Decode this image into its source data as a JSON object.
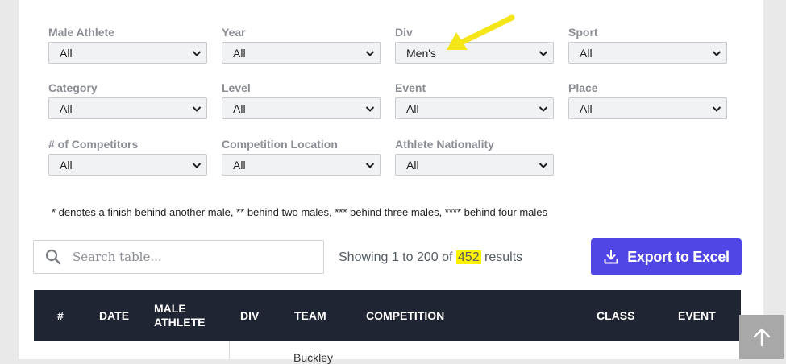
{
  "filters": [
    {
      "label": "Male Athlete",
      "value": "All"
    },
    {
      "label": "Year",
      "value": "All"
    },
    {
      "label": "Div",
      "value": "Men's"
    },
    {
      "label": "Sport",
      "value": "All"
    },
    {
      "label": "Category",
      "value": "All"
    },
    {
      "label": "Level",
      "value": "All"
    },
    {
      "label": "Event",
      "value": "All"
    },
    {
      "label": "Place",
      "value": "All"
    },
    {
      "label": "# of Competitors",
      "value": "All"
    },
    {
      "label": "Competition Location",
      "value": "All"
    },
    {
      "label": "Athlete Nationality",
      "value": "All"
    }
  ],
  "note": "* denotes a finish behind another male, ** behind two males, *** behind three males, **** behind four males",
  "search": {
    "placeholder": "Search table..."
  },
  "results": {
    "prefix": "Showing 1 to 200 of ",
    "total": "452",
    "suffix": " results"
  },
  "export_label": "Export to Excel",
  "table": {
    "columns": [
      "#",
      "DATE",
      "MALE ATHLETE",
      "DIV",
      "TEAM",
      "COMPETITION",
      "CLASS",
      "EVENT"
    ],
    "first_row_team_partial": "Buckley"
  },
  "colors": {
    "accent": "#4f46e5",
    "header_bg": "#1f2533",
    "highlight": "#fff200",
    "annotation_arrow": "#f5e61a"
  },
  "icons": [
    "chevron-down-icon",
    "search-icon",
    "download-icon",
    "arrow-up-icon",
    "annotation-arrow"
  ]
}
